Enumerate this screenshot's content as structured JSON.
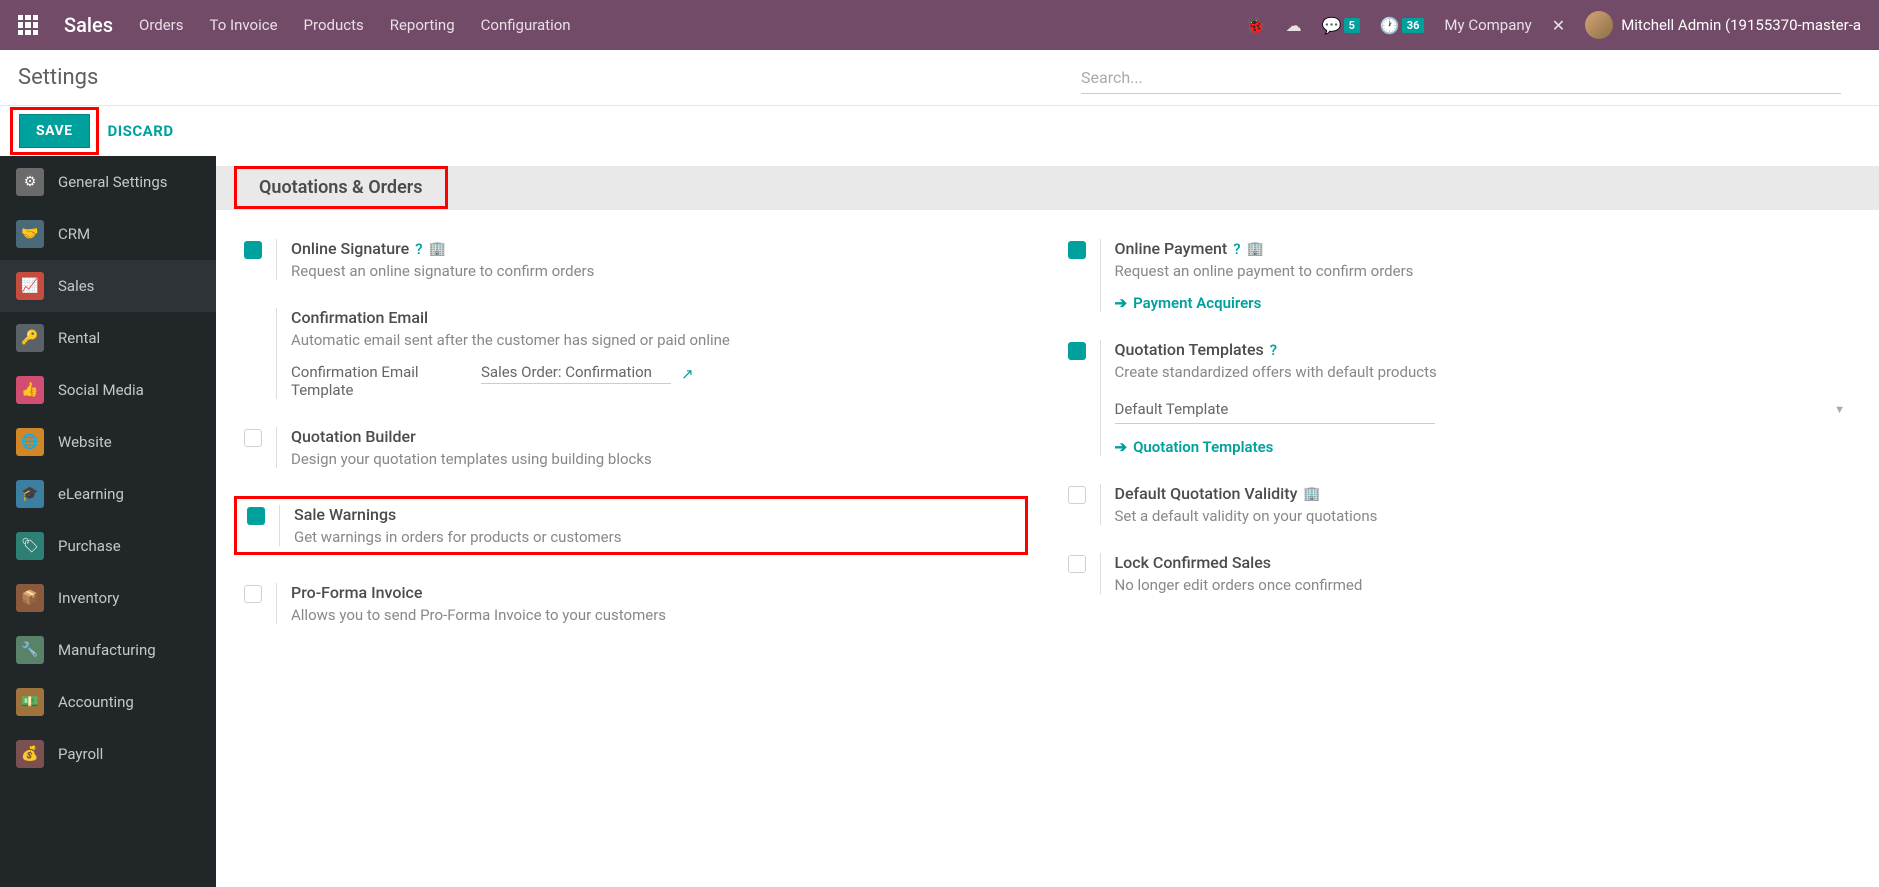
{
  "navbar": {
    "app_title": "Sales",
    "links": [
      "Orders",
      "To Invoice",
      "Products",
      "Reporting",
      "Configuration"
    ],
    "msg_count": "5",
    "activity_count": "36",
    "company": "My Company",
    "user": "Mitchell Admin (19155370-master-a"
  },
  "subheader": {
    "title": "Settings",
    "search_placeholder": "Search..."
  },
  "actions": {
    "save": "SAVE",
    "discard": "DISCARD"
  },
  "sidebar": {
    "items": [
      "General Settings",
      "CRM",
      "Sales",
      "Rental",
      "Social Media",
      "Website",
      "eLearning",
      "Purchase",
      "Inventory",
      "Manufacturing",
      "Accounting",
      "Payroll"
    ]
  },
  "section": {
    "title": "Quotations & Orders"
  },
  "settings": {
    "online_signature": {
      "title": "Online Signature",
      "desc": "Request an online signature to confirm orders"
    },
    "online_payment": {
      "title": "Online Payment",
      "desc": "Request an online payment to confirm orders",
      "link": "Payment Acquirers"
    },
    "confirmation_email": {
      "title": "Confirmation Email",
      "desc": "Automatic email sent after the customer has signed or paid online",
      "field_label": "Confirmation Email Template",
      "field_value": "Sales Order: Confirmation"
    },
    "quotation_templates": {
      "title": "Quotation Templates",
      "desc": "Create standardized offers with default products",
      "select_label": "Default Template",
      "link": "Quotation Templates"
    },
    "quotation_builder": {
      "title": "Quotation Builder",
      "desc": "Design your quotation templates using building blocks"
    },
    "default_validity": {
      "title": "Default Quotation Validity",
      "desc": "Set a default validity on your quotations"
    },
    "sale_warnings": {
      "title": "Sale Warnings",
      "desc": "Get warnings in orders for products or customers"
    },
    "lock_confirmed": {
      "title": "Lock Confirmed Sales",
      "desc": "No longer edit orders once confirmed"
    },
    "proforma": {
      "title": "Pro-Forma Invoice",
      "desc": "Allows you to send Pro-Forma Invoice to your customers"
    }
  }
}
